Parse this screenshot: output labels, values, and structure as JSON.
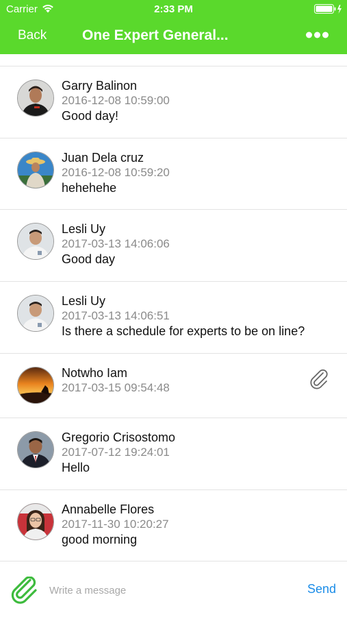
{
  "status_bar": {
    "carrier": "Carrier",
    "time": "2:33 PM"
  },
  "nav": {
    "back_label": "Back",
    "title": "One Expert General..."
  },
  "messages": [
    {
      "name": "Garry Balinon",
      "time": "2016-12-08 10:59:00",
      "text": "Good day!"
    },
    {
      "name": "Juan Dela cruz",
      "time": "2016-12-08 10:59:20",
      "text": "hehehehe"
    },
    {
      "name": "Lesli Uy",
      "time": "2017-03-13 14:06:06",
      "text": "Good day"
    },
    {
      "name": "Lesli Uy",
      "time": "2017-03-13 14:06:51",
      "text": "Is there a schedule for experts to be on line?"
    },
    {
      "name": "Notwho Iam",
      "time": "2017-03-15 09:54:48",
      "text": ""
    },
    {
      "name": "Gregorio Crisostomo",
      "time": "2017-07-12 19:24:01",
      "text": "Hello"
    },
    {
      "name": "Annabelle Flores",
      "time": "2017-11-30 10:20:27",
      "text": "good morning"
    }
  ],
  "composer": {
    "placeholder": "Write a message",
    "send_label": "Send"
  },
  "colors": {
    "header_bg": "#5ad92c",
    "send_blue": "#1a8ce8",
    "attach_green": "#3dbb3d"
  }
}
